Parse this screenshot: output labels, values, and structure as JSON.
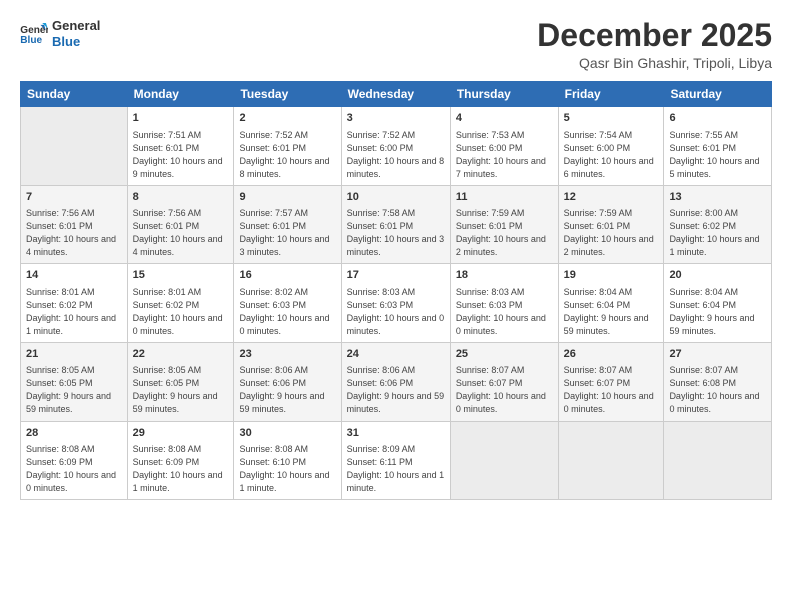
{
  "header": {
    "logo_line1": "General",
    "logo_line2": "Blue",
    "month_title": "December 2025",
    "location": "Qasr Bin Ghashir, Tripoli, Libya"
  },
  "weekdays": [
    "Sunday",
    "Monday",
    "Tuesday",
    "Wednesday",
    "Thursday",
    "Friday",
    "Saturday"
  ],
  "weeks": [
    [
      {
        "num": "",
        "empty": true
      },
      {
        "num": "1",
        "rise": "7:51 AM",
        "set": "6:01 PM",
        "daylight": "10 hours and 9 minutes."
      },
      {
        "num": "2",
        "rise": "7:52 AM",
        "set": "6:01 PM",
        "daylight": "10 hours and 8 minutes."
      },
      {
        "num": "3",
        "rise": "7:52 AM",
        "set": "6:00 PM",
        "daylight": "10 hours and 8 minutes."
      },
      {
        "num": "4",
        "rise": "7:53 AM",
        "set": "6:00 PM",
        "daylight": "10 hours and 7 minutes."
      },
      {
        "num": "5",
        "rise": "7:54 AM",
        "set": "6:00 PM",
        "daylight": "10 hours and 6 minutes."
      },
      {
        "num": "6",
        "rise": "7:55 AM",
        "set": "6:01 PM",
        "daylight": "10 hours and 5 minutes."
      }
    ],
    [
      {
        "num": "7",
        "rise": "7:56 AM",
        "set": "6:01 PM",
        "daylight": "10 hours and 4 minutes."
      },
      {
        "num": "8",
        "rise": "7:56 AM",
        "set": "6:01 PM",
        "daylight": "10 hours and 4 minutes."
      },
      {
        "num": "9",
        "rise": "7:57 AM",
        "set": "6:01 PM",
        "daylight": "10 hours and 3 minutes."
      },
      {
        "num": "10",
        "rise": "7:58 AM",
        "set": "6:01 PM",
        "daylight": "10 hours and 3 minutes."
      },
      {
        "num": "11",
        "rise": "7:59 AM",
        "set": "6:01 PM",
        "daylight": "10 hours and 2 minutes."
      },
      {
        "num": "12",
        "rise": "7:59 AM",
        "set": "6:01 PM",
        "daylight": "10 hours and 2 minutes."
      },
      {
        "num": "13",
        "rise": "8:00 AM",
        "set": "6:02 PM",
        "daylight": "10 hours and 1 minute."
      }
    ],
    [
      {
        "num": "14",
        "rise": "8:01 AM",
        "set": "6:02 PM",
        "daylight": "10 hours and 1 minute."
      },
      {
        "num": "15",
        "rise": "8:01 AM",
        "set": "6:02 PM",
        "daylight": "10 hours and 0 minutes."
      },
      {
        "num": "16",
        "rise": "8:02 AM",
        "set": "6:03 PM",
        "daylight": "10 hours and 0 minutes."
      },
      {
        "num": "17",
        "rise": "8:03 AM",
        "set": "6:03 PM",
        "daylight": "10 hours and 0 minutes."
      },
      {
        "num": "18",
        "rise": "8:03 AM",
        "set": "6:03 PM",
        "daylight": "10 hours and 0 minutes."
      },
      {
        "num": "19",
        "rise": "8:04 AM",
        "set": "6:04 PM",
        "daylight": "9 hours and 59 minutes."
      },
      {
        "num": "20",
        "rise": "8:04 AM",
        "set": "6:04 PM",
        "daylight": "9 hours and 59 minutes."
      }
    ],
    [
      {
        "num": "21",
        "rise": "8:05 AM",
        "set": "6:05 PM",
        "daylight": "9 hours and 59 minutes."
      },
      {
        "num": "22",
        "rise": "8:05 AM",
        "set": "6:05 PM",
        "daylight": "9 hours and 59 minutes."
      },
      {
        "num": "23",
        "rise": "8:06 AM",
        "set": "6:06 PM",
        "daylight": "9 hours and 59 minutes."
      },
      {
        "num": "24",
        "rise": "8:06 AM",
        "set": "6:06 PM",
        "daylight": "9 hours and 59 minutes."
      },
      {
        "num": "25",
        "rise": "8:07 AM",
        "set": "6:07 PM",
        "daylight": "10 hours and 0 minutes."
      },
      {
        "num": "26",
        "rise": "8:07 AM",
        "set": "6:07 PM",
        "daylight": "10 hours and 0 minutes."
      },
      {
        "num": "27",
        "rise": "8:07 AM",
        "set": "6:08 PM",
        "daylight": "10 hours and 0 minutes."
      }
    ],
    [
      {
        "num": "28",
        "rise": "8:08 AM",
        "set": "6:09 PM",
        "daylight": "10 hours and 0 minutes."
      },
      {
        "num": "29",
        "rise": "8:08 AM",
        "set": "6:09 PM",
        "daylight": "10 hours and 1 minute."
      },
      {
        "num": "30",
        "rise": "8:08 AM",
        "set": "6:10 PM",
        "daylight": "10 hours and 1 minute."
      },
      {
        "num": "31",
        "rise": "8:09 AM",
        "set": "6:11 PM",
        "daylight": "10 hours and 1 minute."
      },
      {
        "num": "",
        "empty": true
      },
      {
        "num": "",
        "empty": true
      },
      {
        "num": "",
        "empty": true
      }
    ]
  ]
}
